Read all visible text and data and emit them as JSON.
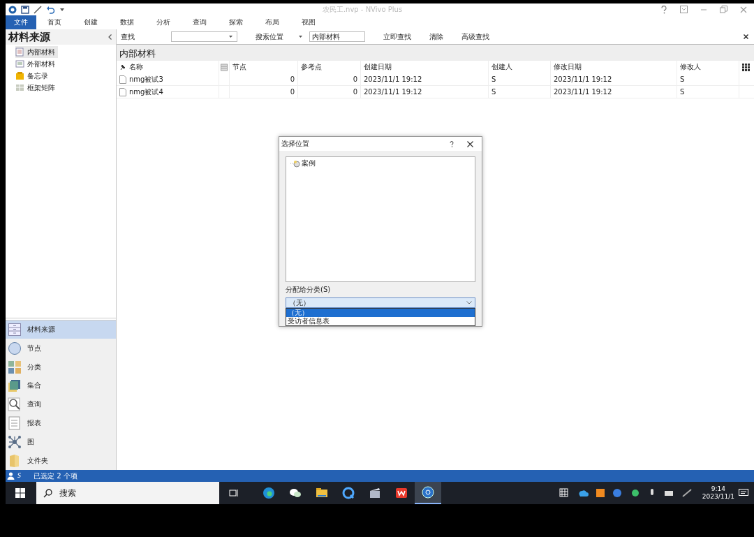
{
  "window": {
    "title": "农民工.nvp - NVivo Plus"
  },
  "ribbon_tabs": [
    {
      "label": "文件",
      "selected": true
    },
    {
      "label": "首页",
      "selected": false
    },
    {
      "label": "创建",
      "selected": false
    },
    {
      "label": "数据",
      "selected": false
    },
    {
      "label": "分析",
      "selected": false
    },
    {
      "label": "查询",
      "selected": false
    },
    {
      "label": "探索",
      "selected": false
    },
    {
      "label": "布局",
      "selected": false
    },
    {
      "label": "视图",
      "selected": false
    }
  ],
  "sidebar": {
    "title": "材料来源",
    "items": [
      {
        "label": "内部材料",
        "selected": true,
        "kind": "internal"
      },
      {
        "label": "外部材料",
        "selected": false,
        "kind": "external"
      },
      {
        "label": "备忘录",
        "selected": false,
        "kind": "memo"
      },
      {
        "label": "框架矩阵",
        "selected": false,
        "kind": "matrix"
      }
    ]
  },
  "find_bar": {
    "label": "查找",
    "search_in_label": "搜索位置",
    "search_in_value": "内部材料",
    "buttons": [
      "立即查找",
      "清除",
      "高级查找"
    ]
  },
  "list": {
    "title": "内部材料",
    "columns": [
      "名称",
      "节点",
      "参考点",
      "创建日期",
      "创建人",
      "修改日期",
      "修改人"
    ],
    "rows": [
      {
        "cells": [
          "nmg被试3",
          "0",
          "0",
          "2023/11/1 19:12",
          "S",
          "2023/11/1 19:12",
          "S"
        ]
      },
      {
        "cells": [
          "nmg被试4",
          "0",
          "0",
          "2023/11/1 19:12",
          "S",
          "2023/11/1 19:12",
          "S"
        ]
      }
    ]
  },
  "navigation": [
    {
      "label": "材料来源",
      "selected": true,
      "kind": "sources"
    },
    {
      "label": "节点",
      "selected": false,
      "kind": "nodes"
    },
    {
      "label": "分类",
      "selected": false,
      "kind": "classifications"
    },
    {
      "label": "集合",
      "selected": false,
      "kind": "sets"
    },
    {
      "label": "查询",
      "selected": false,
      "kind": "queries"
    },
    {
      "label": "报表",
      "selected": false,
      "kind": "reports"
    },
    {
      "label": "图",
      "selected": false,
      "kind": "maps"
    },
    {
      "label": "文件夹",
      "selected": false,
      "kind": "folders"
    }
  ],
  "status_bar": {
    "user": "S",
    "text": "已选定 2 个项"
  },
  "dialog": {
    "title": "选择位置",
    "tree": [
      {
        "label": "案例"
      }
    ],
    "assign_label": "分配给分类(S)",
    "combo_value": "（无）",
    "options": [
      {
        "label": "（无）",
        "selected": true
      },
      {
        "label": "受访者信息表",
        "selected": false
      }
    ]
  },
  "taskbar": {
    "search_placeholder": "搜索",
    "apps": [
      {
        "kind": "edge",
        "selected": false
      },
      {
        "kind": "wechat",
        "selected": false
      },
      {
        "kind": "explorer",
        "selected": false
      },
      {
        "kind": "quark",
        "selected": false
      },
      {
        "kind": "video",
        "selected": false
      },
      {
        "kind": "wps",
        "selected": false
      },
      {
        "kind": "nvivo",
        "selected": true
      }
    ],
    "time": "9:14",
    "date": "2023/11/1"
  }
}
